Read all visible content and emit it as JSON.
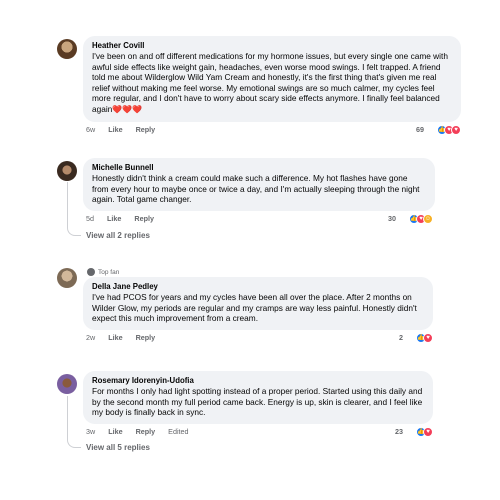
{
  "comments": [
    {
      "author": "Heather Covill",
      "body": "I've been on and off different medications for my hormone issues, but every single one came with awful side effects like weight gain, headaches, even worse mood swings. I felt trapped. A friend told me about Wilderglow Wild Yam Cream and honestly, it's the first thing that's given me real relief without making me feel worse. My emotional swings are so much calmer, my cycles feel more regular, and I don't have to worry about scary side effects anymore. I finally feel balanced again",
      "emoji": "❤️❤️❤️",
      "time": "6w",
      "like": "Like",
      "reply": "Reply",
      "reaction_count": "69"
    },
    {
      "author": "Michelle Bunnell",
      "body": "Honestly didn't think a cream could make such a difference. My hot flashes have gone from every hour to maybe once or twice a day, and I'm actually sleeping through the night again. Total game changer.",
      "time": "5d",
      "like": "Like",
      "reply": "Reply",
      "reaction_count": "30",
      "view_replies": "View all 2 replies"
    },
    {
      "badge": "Top fan",
      "author": "Della Jane Pedley",
      "body": "I've had PCOS for years and my cycles have been all over the place. After 2 months on Wilder Glow, my periods are regular and my cramps are way less painful. Honestly didn't expect this much improvement from a cream.",
      "time": "2w",
      "like": "Like",
      "reply": "Reply",
      "reaction_count": "2"
    },
    {
      "author": "Rosemary Idorenyin-Udofia",
      "body": "For months I only had light spotting instead of a proper period. Started using this daily and by the second month my full period came back. Energy is up, skin is clearer, and I feel like my body is finally back in sync.",
      "time": "3w",
      "like": "Like",
      "reply": "Reply",
      "edited": "Edited",
      "reaction_count": "23",
      "view_replies": "View all 5 replies"
    }
  ],
  "colors": {
    "bubble": "#f0f2f5",
    "meta": "#65676b",
    "like": "#1877f2",
    "love": "#f33e58",
    "haha": "#f7b125"
  }
}
